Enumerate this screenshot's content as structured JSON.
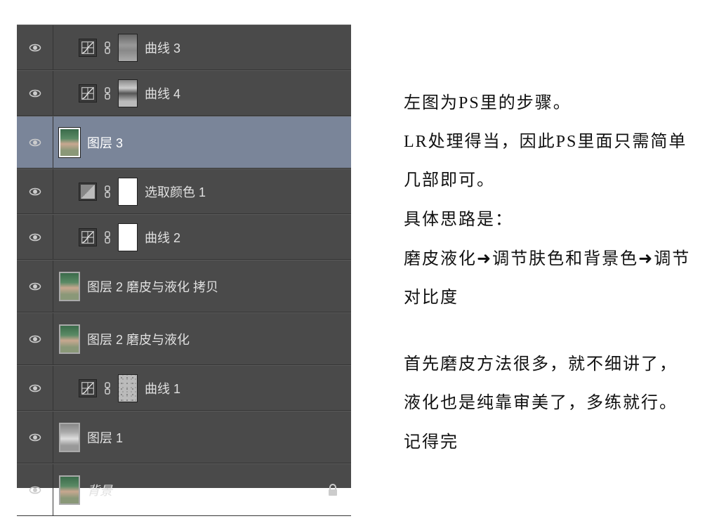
{
  "layers": [
    {
      "name": "曲线 3",
      "type": "curves",
      "mask": "gray1",
      "indent": 1
    },
    {
      "name": "曲线 4",
      "type": "curves",
      "mask": "gray2",
      "indent": 1
    },
    {
      "name": "图层 3",
      "type": "layer",
      "selected": true,
      "indent": 0,
      "tall": true
    },
    {
      "name": "选取颜色 1",
      "type": "selcolor",
      "mask": "white",
      "indent": 1
    },
    {
      "name": "曲线 2",
      "type": "curves",
      "mask": "white",
      "indent": 1
    },
    {
      "name": "图层 2 磨皮与液化 拷贝",
      "type": "layer",
      "indent": 0,
      "tall": true
    },
    {
      "name": "图层 2 磨皮与液化",
      "type": "layer",
      "indent": 0,
      "tall": true
    },
    {
      "name": "曲线 1",
      "type": "curves",
      "mask": "speckle",
      "indent": 1
    },
    {
      "name": "图层 1",
      "type": "layer",
      "bw": true,
      "indent": 0,
      "tall": true
    },
    {
      "name": "背景",
      "type": "bg",
      "locked": true,
      "italic": true,
      "indent": 0,
      "tall": true
    }
  ],
  "article": {
    "p1": "左图为PS里的步骤。",
    "p2": "LR处理得当，因此PS里面只需简单几部即可。",
    "p3": "具体思路是：",
    "p4_a": "磨皮液化",
    "p4_b": "调节肤色和背景色",
    "p4_c": "调节对比度",
    "arrow": "➜",
    "p5": "首先磨皮方法很多，就不细讲了，液化也是纯靠审美了，多练就行。记得完"
  }
}
